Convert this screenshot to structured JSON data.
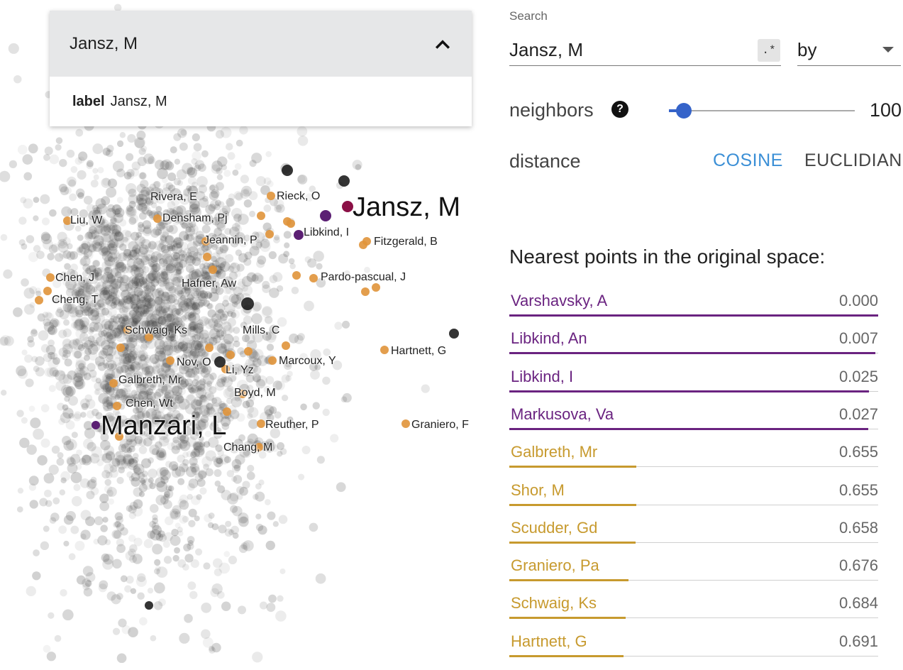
{
  "selector": {
    "title": "Jansz, M",
    "detail_key": "label",
    "detail_value": "Jansz, M"
  },
  "scatter": {
    "purple": "#5b1f73",
    "magenta": "#8b1046",
    "orange": "#e0943a",
    "labels": [
      "Rivera, E",
      "Rieck, O",
      "Jansz, M",
      "Liu, W",
      "Densham, Pj",
      "Libkind, I",
      "Fitzgerald, B",
      "Jeannin, P",
      "Chen, J",
      "Hafner, Aw",
      "Pardo-pascual, J",
      "Cheng, T",
      "Schwaig, Ks",
      "Mills, C",
      "Hartnett, G",
      "Nov, O",
      "Marcoux, Y",
      "Li, Yz",
      "Galbreth, Mr",
      "Boyd, M",
      "Chen, Wt",
      "Manzari, L",
      "Reuther, P",
      "Graniero, F",
      "Chang, M"
    ]
  },
  "panel": {
    "search_label": "Search",
    "search_value": "Jansz, M",
    "regex_label": ".*",
    "by_label": "by",
    "neighbors_label": "neighbors",
    "help_glyph": "?",
    "neighbors_value": "100",
    "neighbors_fraction": 0.08,
    "distance_label": "distance",
    "cosine_label": "COSINE",
    "euclidian_label": "EUCLIDIAN",
    "nearest_title": "Nearest points in the original space:",
    "colors": {
      "purple": "#6a2380",
      "gold": "#c79a2e",
      "accent": "#3b8fd6"
    },
    "nearest": [
      {
        "name": "Varshavsky, A",
        "value": "0.000",
        "group": "purple"
      },
      {
        "name": "Libkind, An",
        "value": "0.007",
        "group": "purple"
      },
      {
        "name": "Libkind, I",
        "value": "0.025",
        "group": "purple"
      },
      {
        "name": "Markusova, Va",
        "value": "0.027",
        "group": "purple"
      },
      {
        "name": "Galbreth, Mr",
        "value": "0.655",
        "group": "gold"
      },
      {
        "name": "Shor, M",
        "value": "0.655",
        "group": "gold"
      },
      {
        "name": "Scudder, Gd",
        "value": "0.658",
        "group": "gold"
      },
      {
        "name": "Graniero, Pa",
        "value": "0.676",
        "group": "gold"
      },
      {
        "name": "Schwaig, Ks",
        "value": "0.684",
        "group": "gold"
      },
      {
        "name": "Hartnett, G",
        "value": "0.691",
        "group": "gold"
      }
    ]
  }
}
